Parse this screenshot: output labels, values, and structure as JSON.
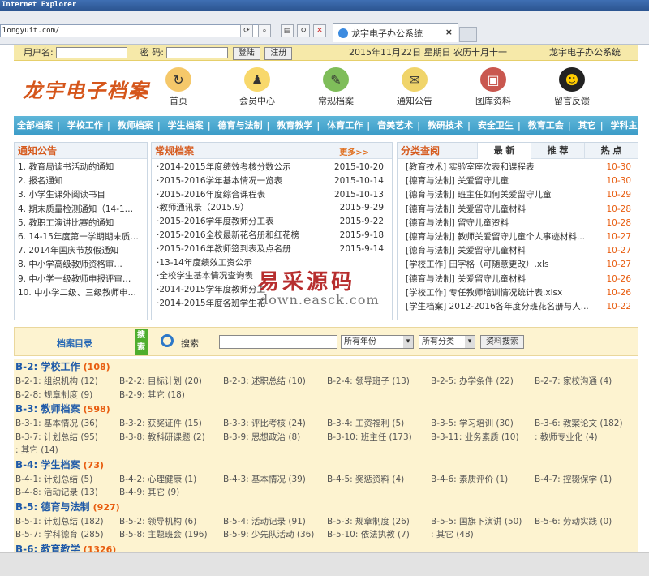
{
  "browser": {
    "title": "Internet Explorer",
    "address": "longyuit.com/",
    "tab_title": "龙宇电子办公系统",
    "tab_close": "×"
  },
  "topbar": {
    "user_label": "用户名:",
    "pass_label": "密 码:",
    "login": "登陆",
    "register": "注册",
    "date": "2015年11月22日 星期日 农历十月十一",
    "system": "龙宇电子办公系统"
  },
  "logo": "龙宇电子档案",
  "nav": [
    {
      "label": "首页",
      "icon": "home-icon"
    },
    {
      "label": "会员中心",
      "icon": "member-icon"
    },
    {
      "label": "常规档案",
      "icon": "archive-icon"
    },
    {
      "label": "通知公告",
      "icon": "notice-icon"
    },
    {
      "label": "图库资料",
      "icon": "gallery-icon"
    },
    {
      "label": "留言反馈",
      "icon": "feedback-icon"
    }
  ],
  "menu": [
    "全部档案",
    "学校工作",
    "教师档案",
    "学生档案",
    "德育与法制",
    "教育教学",
    "体育工作",
    "音美艺术",
    "教研技术",
    "安全卫生",
    "教育工会",
    "其它",
    "学科主页"
  ],
  "notice": {
    "title": "通知公告",
    "items": [
      "1. 教育局读书活动的通知",
      "2. 报名通知",
      "3. 小学生课外阅读书目",
      "4. 期末质量检测通知（14-1…",
      "5. 教职工演讲比赛的通知",
      "6. 14-15年度第一学期期末质…",
      "7. 2014年国庆节放假通知",
      "8. 中小学高级教师资格审…",
      "9. 中小学一级教师申报评审…",
      "10. 中小学二级、三级教师申…"
    ]
  },
  "regular": {
    "title": "常规档案",
    "more": "更多>>",
    "items": [
      {
        "t": "·2014-2015年度绩效考核分数公示",
        "d": "2015-10-20"
      },
      {
        "t": "·2015-2016学年基本情况一览表",
        "d": "2015-10-14"
      },
      {
        "t": "·2015-2016年度综合课程表",
        "d": "2015-10-13"
      },
      {
        "t": "·教师通讯录（2015.9）",
        "d": "2015-9-29"
      },
      {
        "t": "·2015-2016学年度教师分工表",
        "d": "2015-9-22"
      },
      {
        "t": "·2015-2016全校最新花名册和红花榜",
        "d": "2015-9-18"
      },
      {
        "t": "·2015-2016年教师签到表及点名册",
        "d": "2015-9-14"
      },
      {
        "t": "·13-14年度绩效工资公示",
        "d": ""
      },
      {
        "t": "·全校学生基本情况查询表",
        "d": ""
      },
      {
        "t": "·2014-2015学年度教师分工",
        "d": ""
      },
      {
        "t": "·2014-2015年度各班学生花",
        "d": ""
      }
    ]
  },
  "classify": {
    "title": "分类查阅",
    "tabs": [
      "最 新",
      "推 荐",
      "热 点"
    ],
    "items": [
      {
        "t": "[教育技术] 实验室座次表和课程表",
        "d": "10-30"
      },
      {
        "t": "[德育与法制] 关爱留守儿童",
        "d": "10-30"
      },
      {
        "t": "[德育与法制] 班主任如何关爱留守儿童",
        "d": "10-29"
      },
      {
        "t": "[德育与法制] 关爱留守儿童材料",
        "d": "10-28"
      },
      {
        "t": "[德育与法制] 留守儿童资料",
        "d": "10-28"
      },
      {
        "t": "[德育与法制] 教师关爱留守儿童个人事迹材料...",
        "d": "10-27"
      },
      {
        "t": "[德育与法制] 关爱留守儿童材料",
        "d": "10-27"
      },
      {
        "t": "[学校工作] 田字格（可随意更改）.xls",
        "d": "10-27"
      },
      {
        "t": "[德育与法制] 关爱留守儿童材料",
        "d": "10-26"
      },
      {
        "t": "[学校工作] 专任教师培训情况统计表.xlsx",
        "d": "10-26"
      },
      {
        "t": "[学生档案] 2012-2016各年度分班花名册与人...",
        "d": "10-22"
      }
    ]
  },
  "watermark": {
    "cn": "易采源码",
    "en": "down.easck.com"
  },
  "archive": {
    "title": "档案目录",
    "tag": "搜索",
    "search_label": "搜索",
    "year": "所有年份",
    "category": "所有分类",
    "submit": "资料搜索"
  },
  "categories": [
    {
      "name": "B-2: 学校工作",
      "count": "(108)",
      "items": [
        "B-2-1: 组织机构 (12)",
        "B-2-2: 目标计划 (20)",
        "B-2-3: 述职总结 (10)",
        "B-2-4: 领导班子 (13)",
        "B-2-5: 办学条件 (22)",
        "B-2-7: 家校沟通 (4)",
        "B-2-8: 规章制度 (9)",
        "B-2-9: 其它 (18)"
      ]
    },
    {
      "name": "B-3: 教师档案",
      "count": "(598)",
      "items": [
        "B-3-1: 基本情况 (36)",
        "B-3-2: 获奖证件 (15)",
        "B-3-3: 评比考核 (24)",
        "B-3-4: 工资福利 (5)",
        "B-3-5: 学习培训 (30)",
        "B-3-6: 教案论文 (182)",
        "B-3-7: 计划总结 (95)",
        "B-3-8: 教科研课题 (2)",
        "B-3-9: 思想政治 (8)",
        "B-3-10: 班主任 (173)",
        "B-3-11: 业务素质 (10)",
        ": 教师专业化 (4)",
        ": 其它 (14)"
      ]
    },
    {
      "name": "B-4: 学生档案",
      "count": "(73)",
      "items": [
        "B-4-1: 计划总结 (5)",
        "B-4-2: 心理健康 (1)",
        "B-4-3: 基本情况 (39)",
        "B-4-5: 奖惩资料 (4)",
        "B-4-6: 素质评价 (1)",
        "B-4-7: 控辍保学 (1)",
        "B-4-8: 活动记录 (13)",
        "B-4-9: 其它 (9)"
      ]
    },
    {
      "name": "B-5: 德育与法制",
      "count": "(927)",
      "items": [
        "B-5-1: 计划总结 (182)",
        "B-5-2: 领导机构 (6)",
        "B-5-4: 活动记录 (91)",
        "B-5-3: 规章制度 (26)",
        "B-5-5: 国旗下演讲 (50)",
        "B-5-6: 劳动实践 (0)",
        "B-5-7: 学科德育 (285)",
        "B-5-8: 主题班会 (196)",
        "B-5-9: 少先队活动 (36)",
        "B-5-10: 依法执教 (7)",
        ": 其它 (48)"
      ]
    },
    {
      "name": "B-6: 教育教学",
      "count": "(1326)",
      "items": []
    }
  ]
}
